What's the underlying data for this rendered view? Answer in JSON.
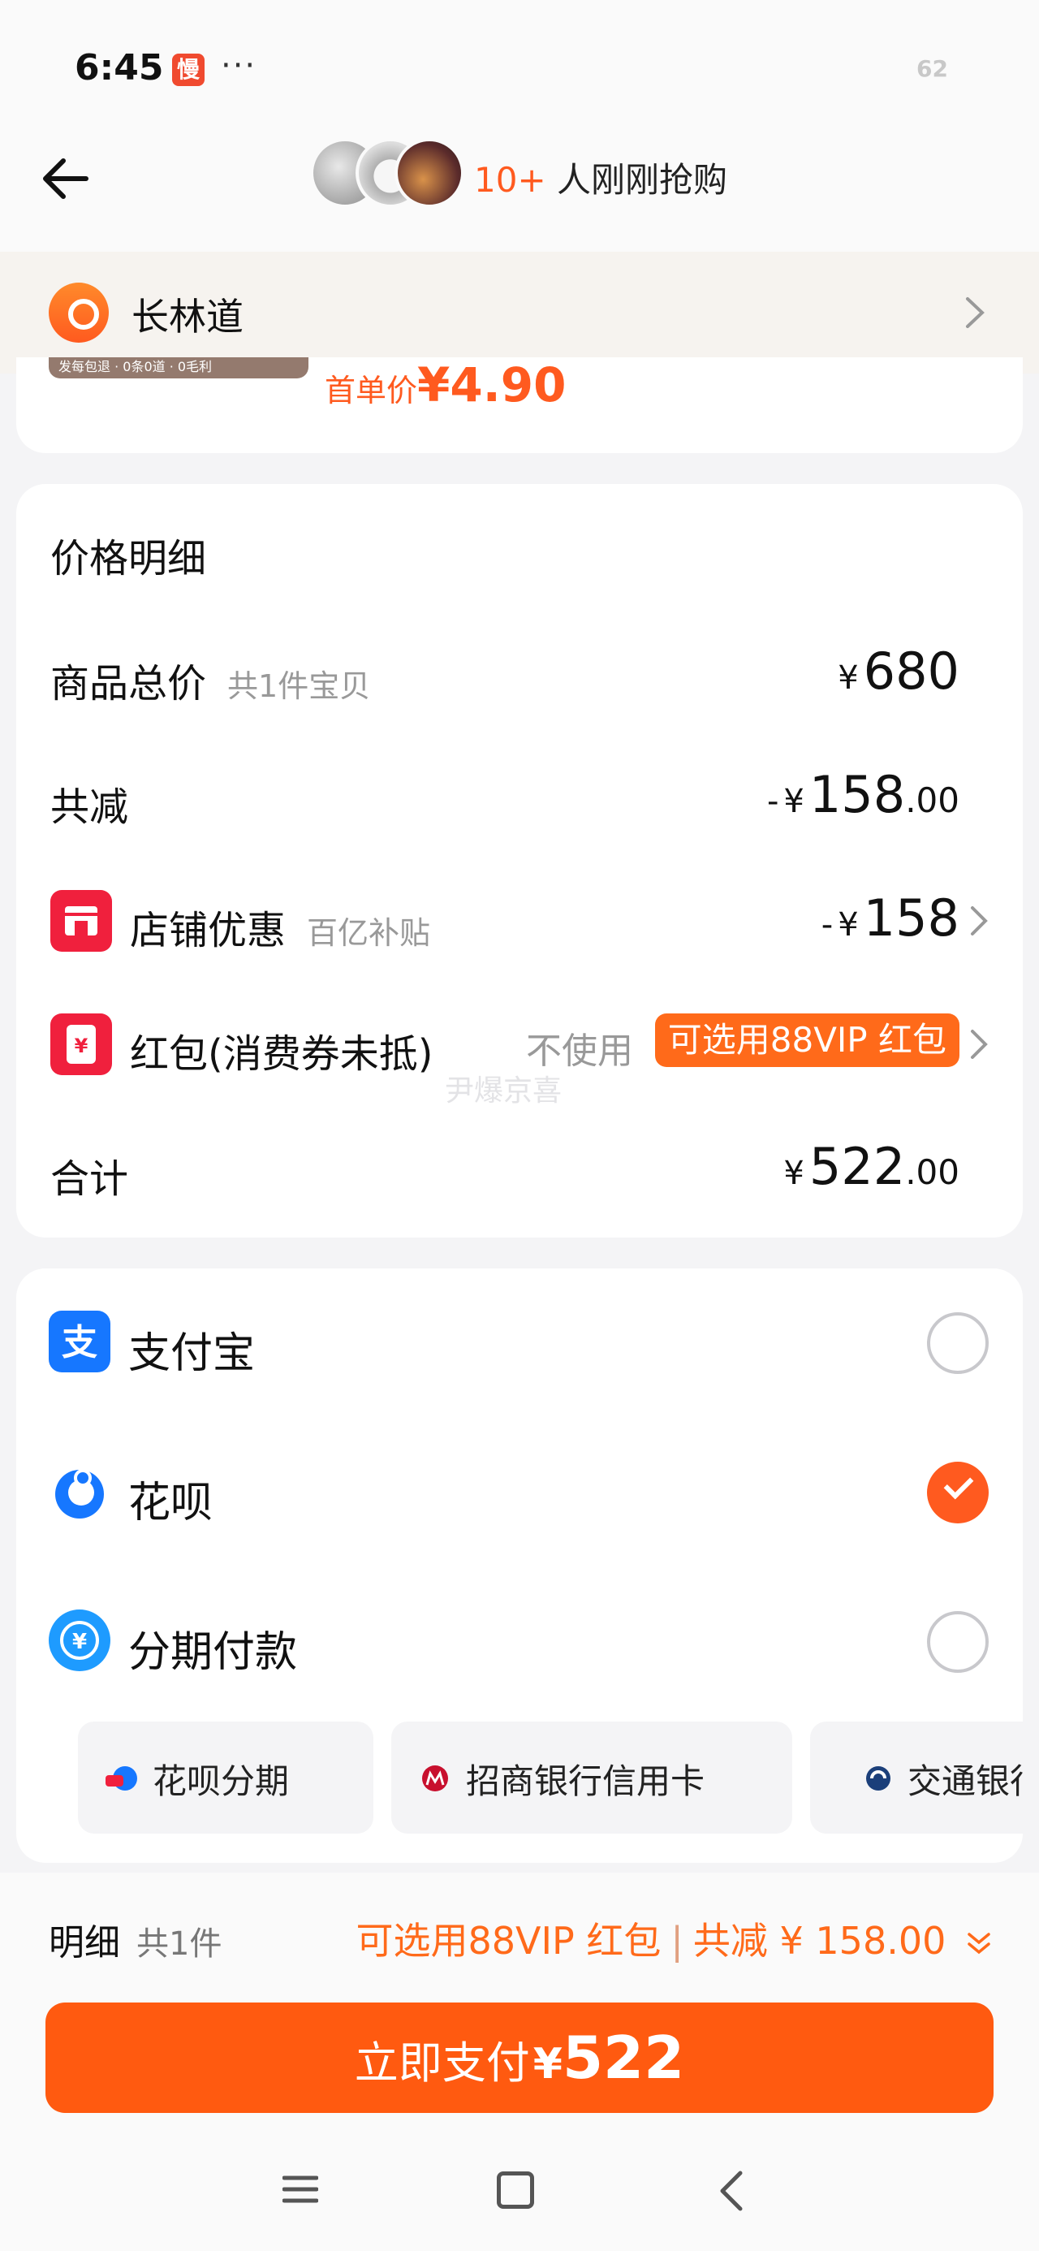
{
  "status_bar": {
    "time": "6:45",
    "app_badge": "慢",
    "dots": "···",
    "battery": "62"
  },
  "header": {
    "buyers_count": "10+",
    "buyers_text": " 人刚刚抢购"
  },
  "address": {
    "name": "长林道"
  },
  "product": {
    "tags": "发每包退 · 0条0道 · 0毛利",
    "first_price_label": "首单价",
    "first_price_value": "¥4.90"
  },
  "price_detail": {
    "title": "价格明细",
    "total_label": "商品总价",
    "total_sub": "共1件宝贝",
    "total_yen": "¥",
    "total_value": "680",
    "discount_label": "共减",
    "discount_prefix": "-",
    "discount_yen": "¥",
    "discount_int": "158",
    "discount_dec": ".00",
    "store_label": "店铺优惠",
    "store_sub": "百亿补贴",
    "store_prefix": "-",
    "store_yen": "¥",
    "store_value": "158",
    "redpack_label": "红包(消费券未抵)",
    "redpack_status": "不使用",
    "redpack_pill": "可选用88VIP 红包",
    "sum_label": "合计",
    "sum_yen": "¥",
    "sum_int": "522",
    "sum_dec": ".00",
    "watermark": "尹爆京喜"
  },
  "payment": {
    "methods": [
      {
        "label": "支付宝",
        "selected": false
      },
      {
        "label": "花呗",
        "selected": true
      },
      {
        "label": "分期付款",
        "selected": false
      }
    ],
    "options": [
      "花呗分期",
      "招商银行信用卡",
      "交通银行信用卡"
    ],
    "accent": "#ff5a1f"
  },
  "bottom": {
    "detail_label": "明细",
    "detail_count": "共1件",
    "vip_text": "可选用88VIP 红包",
    "separator": "|",
    "total_discount": "共减 ¥ 158.00",
    "pay_label": "立即支付",
    "pay_yen": "¥",
    "pay_amount": "522"
  }
}
